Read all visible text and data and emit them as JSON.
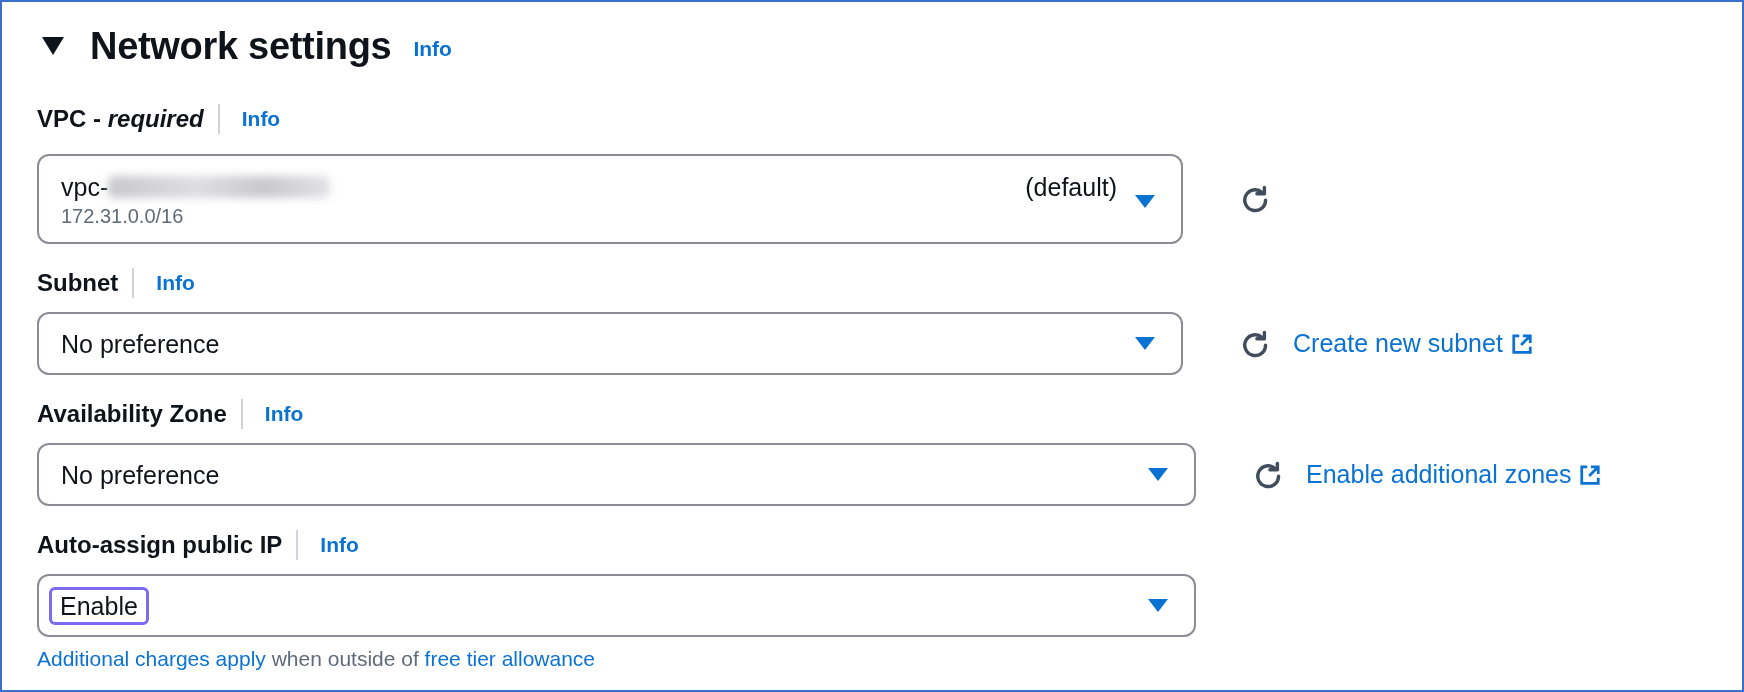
{
  "section": {
    "title": "Network settings",
    "expanded": true,
    "info": "Info"
  },
  "fields": [
    {
      "kind": "vpc",
      "label": "VPC - *required*",
      "info": "Info",
      "value": "vpc-",
      "redacted": true,
      "tag": "(default)",
      "secondary": "172.31.0.0/16",
      "refresh": true
    },
    {
      "kind": "select",
      "label": "Subnet",
      "info": "Info",
      "value": "No preference",
      "refresh": true,
      "link": "Create new subnet"
    },
    {
      "kind": "select",
      "label": "Availability Zone",
      "info": "Info",
      "value": "No preference",
      "refresh": true,
      "link": "Enable additional zones"
    },
    {
      "kind": "select",
      "label": "Auto-assign public IP",
      "info": "Info",
      "value": "Enable",
      "focused": true,
      "refresh": false
    }
  ],
  "note": [
    {
      "kind": "link",
      "text": "Additional charges apply"
    },
    {
      "kind": "text",
      "text": " when outside of "
    },
    {
      "kind": "link",
      "text": "free tier allowance"
    }
  ]
}
